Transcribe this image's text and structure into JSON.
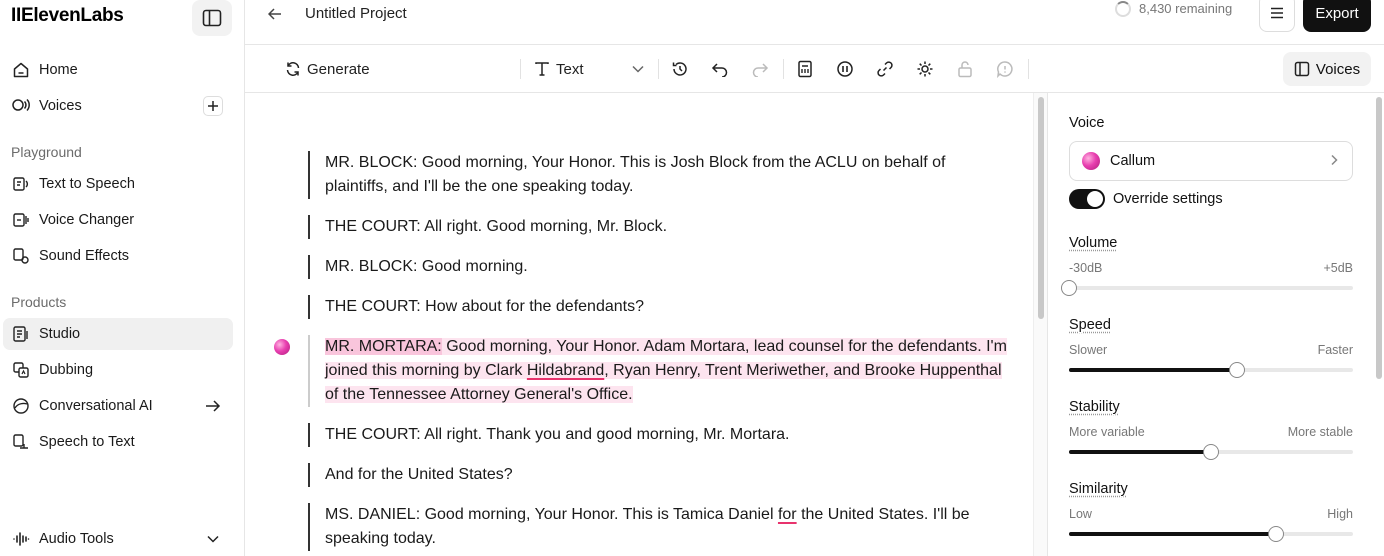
{
  "brand": {
    "logo_text": "IIElevenLabs"
  },
  "sidebar": {
    "top_items": [
      {
        "label": "Home",
        "icon": "home-icon"
      },
      {
        "label": "Voices",
        "icon": "voices-icon"
      }
    ],
    "playground_label": "Playground",
    "playground_items": [
      {
        "label": "Text to Speech"
      },
      {
        "label": "Voice Changer"
      },
      {
        "label": "Sound Effects"
      }
    ],
    "products_label": "Products",
    "products_items": [
      {
        "label": "Studio",
        "active": true
      },
      {
        "label": "Dubbing"
      },
      {
        "label": "Conversational AI"
      },
      {
        "label": "Speech to Text"
      }
    ],
    "bottom_item": {
      "label": "Audio Tools"
    }
  },
  "topbar": {
    "project_title": "Untitled Project",
    "remaining": "8,430 remaining",
    "export_label": "Export"
  },
  "toolbar": {
    "generate_label": "Generate",
    "format_label": "Text",
    "voices_label": "Voices"
  },
  "editor": {
    "paragraphs": [
      {
        "text": "MR. BLOCK: Good morning, Your Honor. This is Josh Block from the ACLU on behalf of plaintiffs, and I'll be the one speaking today."
      },
      {
        "text": "THE COURT: All right. Good morning, Mr. Block."
      },
      {
        "text": "MR. BLOCK: Good morning."
      },
      {
        "text": "THE COURT: How about for the defendants?"
      },
      {
        "speaker": "MR. MORTARA:",
        "part1": " Good morning, Your Honor. Adam Mortara, lead counsel for the defendants. I'm joined this morning by Clark ",
        "flagged": "Hildabrand",
        "part2": ", Ryan Henry, Trent Meriwether, and Brooke Huppenthal of the Tennessee Attorney General's Office."
      },
      {
        "text": "THE COURT: All right. Thank you and good morning, Mr. Mortara."
      },
      {
        "text": "And for the United States?"
      },
      {
        "part1": "MS. DANIEL: Good morning, Your Honor. This is Tamica Daniel ",
        "flagged": "for",
        "part2": " the United States. I'll be speaking today."
      }
    ]
  },
  "panel": {
    "voice_label": "Voice",
    "voice_name": "Callum",
    "override_label": "Override settings",
    "override_on": true,
    "volume": {
      "label": "Volume",
      "min_label": "-30dB",
      "max_label": "+5dB",
      "value": 0.0
    },
    "speed": {
      "label": "Speed",
      "min_label": "Slower",
      "max_label": "Faster",
      "value": 0.59
    },
    "stability": {
      "label": "Stability",
      "min_label": "More variable",
      "max_label": "More stable",
      "value": 0.5
    },
    "similarity": {
      "label": "Similarity",
      "min_label": "Low",
      "max_label": "High",
      "value": 0.73
    }
  },
  "colors": {
    "highlight_bg": "#fde4ef",
    "speaker_bg": "#f9c5dc",
    "squiggle": "#e8336d",
    "accent_dark": "#111111"
  }
}
